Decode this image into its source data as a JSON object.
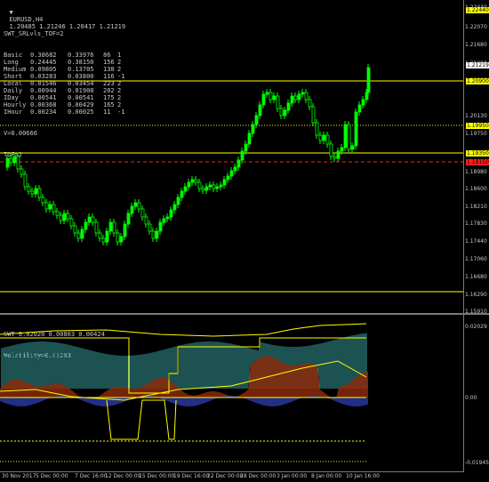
{
  "header": {
    "symbol": "EURUSD,H4",
    "ohlc": "1.20485 1.21246 1.20417 1.21219"
  },
  "info_panel": {
    "title": "SWT_SRLvls_TOF=2",
    "rows": [
      [
        "Basic",
        "0.38682",
        "0.33976",
        "86",
        "1"
      ],
      [
        "Long",
        "0.24445",
        "0.38150",
        "156",
        "2"
      ],
      [
        "Medium",
        "0.09805",
        "0.13705",
        "138",
        "2"
      ],
      [
        "Short",
        "0.03283",
        "0.03800",
        "116",
        "-1"
      ],
      [
        "Local",
        "0.01546",
        "0.03454",
        "223",
        "2"
      ],
      [
        "Daily",
        "0.00944",
        "0.01908",
        "202",
        "2"
      ],
      [
        "IDay",
        "0.00541",
        "0.00541",
        "175",
        "2"
      ],
      [
        "Hourly",
        "0.00368",
        "0.00429",
        "165",
        "2"
      ],
      [
        "IHour",
        "0.00234",
        "0.00025",
        "11",
        "-1"
      ]
    ],
    "v_line": "V=0.00666",
    "tof_line": "TOF=2"
  },
  "price_axis": {
    "labels": [
      "1.22440",
      "1.22070",
      "1.21680",
      "1.21290",
      "1.20900",
      "1.20130",
      "1.19750",
      "1.19360",
      "1.18980",
      "1.18600",
      "1.18210",
      "1.17830",
      "1.17440",
      "1.17060",
      "1.16680",
      "1.16290",
      "1.15910"
    ],
    "tags": [
      {
        "text": "1.22440",
        "bg": "#ffff00",
        "fg": "#000000"
      },
      {
        "text": "1.21219",
        "bg": "#ffffff",
        "fg": "#000000"
      },
      {
        "text": "1.20900",
        "bg": "#ffff00",
        "fg": "#000000"
      },
      {
        "text": "1.19950",
        "bg": "#ffff00",
        "fg": "#000000"
      },
      {
        "text": "1.19350",
        "bg": "#ffff00",
        "fg": "#000000"
      },
      {
        "text": "1.19150",
        "bg": "#ff2020",
        "fg": "#000000"
      }
    ]
  },
  "indicator": {
    "title": "SWT 0.02020 0.00803 0.00424",
    "volatility": "Volatility=0.03283",
    "axis_labels": [
      "0.02029",
      "0.00",
      "-0.01945"
    ]
  },
  "time_axis": [
    "30 Nov 2017",
    "5 Dec 00:00",
    "7 Dec 16:00",
    "12 Dec 00:00",
    "15 Dec 00:00",
    "19 Dec 16:00",
    "22 Dec 00:00",
    "28 Dec 00:00",
    "3 Jan 00:00",
    "8 Jan 00:00",
    "10 Jan 16:00"
  ],
  "colors": {
    "candle": "#00ff00",
    "level_yellow": "#ffff00",
    "level_red": "#ff2020",
    "histogram_teal": "#39a3a3",
    "histogram_blue": "#2c3aa8",
    "area_brown": "#8b2a0a"
  }
}
